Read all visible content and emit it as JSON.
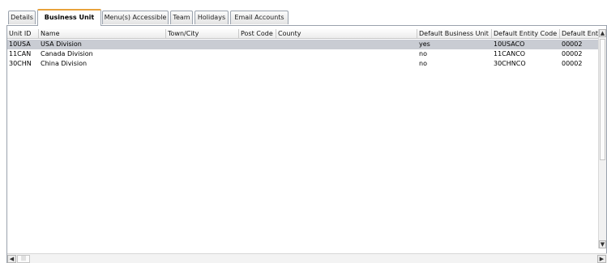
{
  "tabs": [
    {
      "label": "Details",
      "active": false
    },
    {
      "label": "Business Unit",
      "active": true
    },
    {
      "label": "Menu(s) Accessible",
      "active": false
    },
    {
      "label": "Team",
      "active": false
    },
    {
      "label": "Holidays",
      "active": false
    },
    {
      "label": "Email Accounts",
      "active": false
    }
  ],
  "table": {
    "columns": [
      "Unit ID",
      "Name",
      "Town/City",
      "Post Code",
      "County",
      "Default Business Unit",
      "Default Entity Code",
      "Default Ent"
    ],
    "rows": [
      {
        "selected": true,
        "cells": [
          "10USA",
          "USA Division",
          "",
          "",
          "",
          "yes",
          "10USACO",
          "00002"
        ]
      },
      {
        "selected": false,
        "cells": [
          "11CAN",
          "Canada Division",
          "",
          "",
          "",
          "no",
          "11CANCO",
          "00002"
        ]
      },
      {
        "selected": false,
        "cells": [
          "30CHN",
          "China Division",
          "",
          "",
          "",
          "no",
          "30CHNCO",
          "00002"
        ]
      }
    ]
  },
  "scrollbars": {
    "up_arrow": "▲",
    "down_arrow": "▼",
    "left_arrow": "◀",
    "right_arrow": "▶",
    "grip": "|||"
  }
}
